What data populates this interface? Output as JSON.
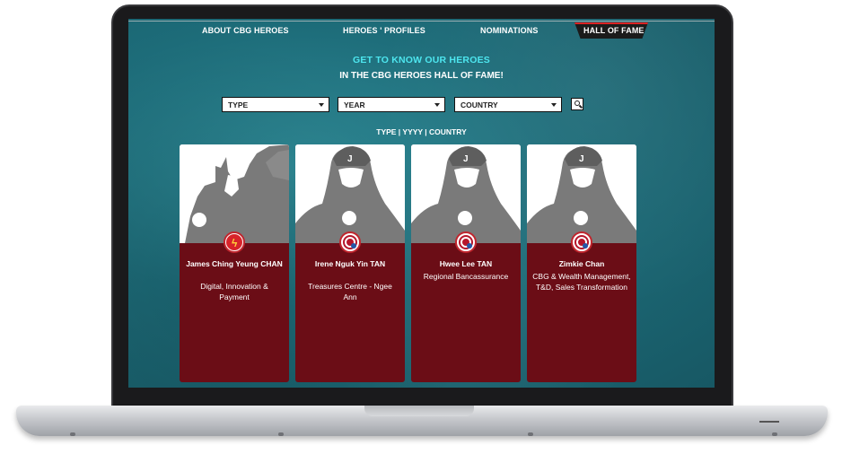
{
  "nav": {
    "items": [
      "ABOUT CBG HEROES",
      "HEROES ' PROFILES",
      "NOMINATIONS"
    ],
    "active": "HALL OF FAME"
  },
  "header": {
    "line1": "GET TO KNOW OUR HEROES",
    "line2": "IN THE CBG HEROES HALL OF FAME!"
  },
  "filters": {
    "type": "TYPE",
    "year": "YEAR",
    "country": "COUNTRY",
    "search_icon": "search-icon",
    "summary": "TYPE | YYYY | COUNTRY"
  },
  "cards": [
    {
      "name": "James Ching Yeung CHAN",
      "dept": "Digital, Innovation & Payment",
      "hero_icon": "flash-icon"
    },
    {
      "name": "Irene Nguk Yin TAN",
      "dept": "Treasures Centre - Ngee Ann",
      "hero_icon": "shield-icon"
    },
    {
      "name": "Hwee Lee TAN",
      "dept": "Regional Bancassurance",
      "hero_icon": "shield-icon"
    },
    {
      "name": "Zimkie Chan",
      "dept": "CBG & Wealth Management, T&D, Sales Transformation",
      "hero_icon": "shield-icon"
    }
  ],
  "colors": {
    "background_teal": "#1d6c79",
    "accent_cyan": "#4de6ef",
    "card_maroon": "#6b0d16",
    "silhouette_gray": "#7a7a7a"
  }
}
